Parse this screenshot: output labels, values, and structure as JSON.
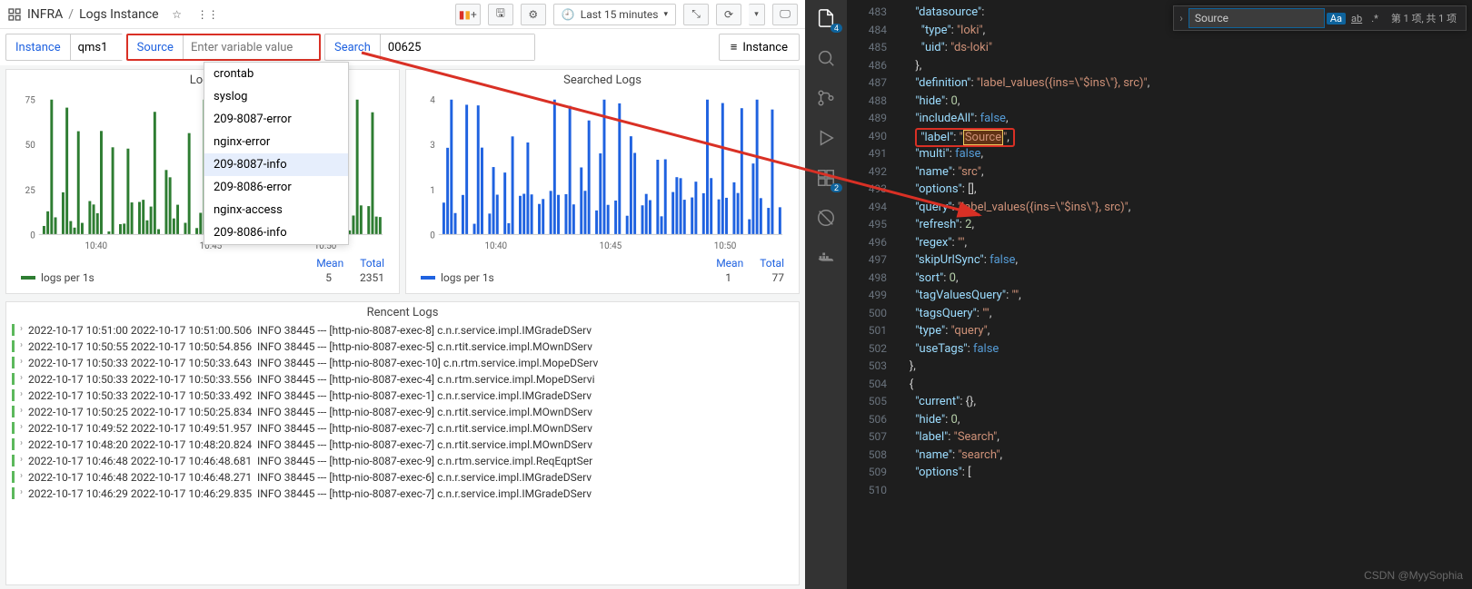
{
  "header": {
    "folder": "INFRA",
    "page": "Logs Instance",
    "time_label": "Last 15 minutes"
  },
  "vars": {
    "instance": {
      "label": "Instance",
      "value": "qms1"
    },
    "source": {
      "label": "Source",
      "placeholder": "Enter variable value"
    },
    "search": {
      "label": "Search",
      "value": "00625"
    },
    "legend_btn": "Instance"
  },
  "dropdown": {
    "items": [
      "crontab",
      "syslog",
      "209-8087-error",
      "nginx-error",
      "209-8087-info",
      "209-8086-error",
      "nginx-access",
      "209-8086-info"
    ],
    "selected": "209-8087-info"
  },
  "panels": {
    "left_title": "Logs",
    "right_title": "Searched Logs",
    "cols": [
      "Mean",
      "Total"
    ],
    "series_label": "logs per 1s",
    "left_stats": {
      "mean": "5",
      "total": "2351"
    },
    "right_stats": {
      "mean": "1",
      "total": "77"
    }
  },
  "chart_data": [
    {
      "type": "bar",
      "title": "Logs",
      "xlabel": "",
      "ylabel": "",
      "categories": [
        "10:40",
        "10:45",
        "10:50"
      ],
      "ylim": [
        0,
        75
      ],
      "color": "#2e7d32",
      "series": [
        {
          "name": "logs per 1s",
          "values_sample": [
            0,
            5,
            10,
            70,
            15,
            0,
            20,
            55,
            8,
            12,
            60,
            5,
            0,
            30,
            25,
            10,
            45,
            0,
            5,
            50
          ]
        }
      ],
      "legend": {
        "mean": 5,
        "total": 2351
      }
    },
    {
      "type": "bar",
      "title": "Searched Logs",
      "xlabel": "",
      "ylabel": "",
      "categories": [
        "10:40",
        "10:45",
        "10:50"
      ],
      "ylim": [
        0,
        4
      ],
      "color": "#1f62e0",
      "series": [
        {
          "name": "logs per 1s",
          "values_sample": [
            0,
            1,
            2,
            4,
            1,
            0,
            1,
            3,
            0,
            1,
            4,
            2,
            0,
            1,
            3,
            1,
            0,
            2,
            1,
            3
          ]
        }
      ],
      "legend": {
        "mean": 1,
        "total": 77
      }
    }
  ],
  "logs": {
    "title": "Rencent Logs",
    "lines": [
      "2022-10-17 10:51:00 2022-10-17 10:51:00.506  INFO 38445 --- [http-nio-8087-exec-8] c.n.r.service.impl.IMGradeDServ",
      "2022-10-17 10:50:55 2022-10-17 10:50:54.856  INFO 38445 --- [http-nio-8087-exec-5] c.n.rtit.service.impl.MOwnDServ",
      "2022-10-17 10:50:33 2022-10-17 10:50:33.643  INFO 38445 --- [http-nio-8087-exec-10] c.n.rtm.service.impl.MopeDServ",
      "2022-10-17 10:50:33 2022-10-17 10:50:33.556  INFO 38445 --- [http-nio-8087-exec-4] c.n.rtm.service.impl.MopeDServi",
      "2022-10-17 10:50:33 2022-10-17 10:50:33.492  INFO 38445 --- [http-nio-8087-exec-1] c.n.r.service.impl.IMGradeDServ",
      "2022-10-17 10:50:25 2022-10-17 10:50:25.834  INFO 38445 --- [http-nio-8087-exec-9] c.n.rtit.service.impl.MOwnDServ",
      "2022-10-17 10:49:52 2022-10-17 10:49:51.957  INFO 38445 --- [http-nio-8087-exec-7] c.n.rtit.service.impl.MOwnDServ",
      "2022-10-17 10:48:20 2022-10-17 10:48:20.824  INFO 38445 --- [http-nio-8087-exec-7] c.n.rtit.service.impl.MOwnDServ",
      "2022-10-17 10:46:48 2022-10-17 10:46:48.681  INFO 38445 --- [http-nio-8087-exec-9] c.n.rtm.service.impl.ReqEqptSer",
      "2022-10-17 10:46:48 2022-10-17 10:46:48.271  INFO 38445 --- [http-nio-8087-exec-6] c.n.r.service.impl.IMGradeDServ",
      "2022-10-17 10:46:29 2022-10-17 10:46:29.835  INFO 38445 --- [http-nio-8087-exec-7] c.n.r.service.impl.IMGradeDServ"
    ]
  },
  "editor": {
    "badges": {
      "explorer": "4",
      "ext": "2"
    },
    "search": {
      "value": "Source",
      "result": "第 1 项, 共 1 项"
    },
    "start_line": 483,
    "lines": [
      {
        "t": "      \"datasource\":"
      },
      {
        "t": "        \"type\": \"loki\","
      },
      {
        "t": "        \"uid\": \"ds-loki\""
      },
      {
        "t": "      },"
      },
      {
        "t": "      \"definition\": \"label_values({ins=\\\"$ins\\\"}, src)\","
      },
      {
        "t": "      \"hide\": 0,"
      },
      {
        "t": "      \"includeAll\": false,"
      },
      {
        "t": "      \"label\": \"Source\",",
        "hl": true
      },
      {
        "t": "      \"multi\": false,"
      },
      {
        "t": "      \"name\": \"src\","
      },
      {
        "t": "      \"options\": [],"
      },
      {
        "t": "      \"query\": \"label_values({ins=\\\"$ins\\\"}, src)\","
      },
      {
        "t": "      \"refresh\": 2,"
      },
      {
        "t": "      \"regex\": \"\","
      },
      {
        "t": "      \"skipUrlSync\": false,"
      },
      {
        "t": "      \"sort\": 0,"
      },
      {
        "t": "      \"tagValuesQuery\": \"\","
      },
      {
        "t": "      \"tagsQuery\": \"\","
      },
      {
        "t": "      \"type\": \"query\","
      },
      {
        "t": "      \"useTags\": false"
      },
      {
        "t": "    },"
      },
      {
        "t": "    {"
      },
      {
        "t": "      \"current\": {},"
      },
      {
        "t": "      \"hide\": 0,"
      },
      {
        "t": "      \"label\": \"Search\","
      },
      {
        "t": "      \"name\": \"search\","
      },
      {
        "t": "      \"options\": ["
      },
      {
        "t": ""
      }
    ]
  },
  "watermark": "CSDN @MyySophia"
}
